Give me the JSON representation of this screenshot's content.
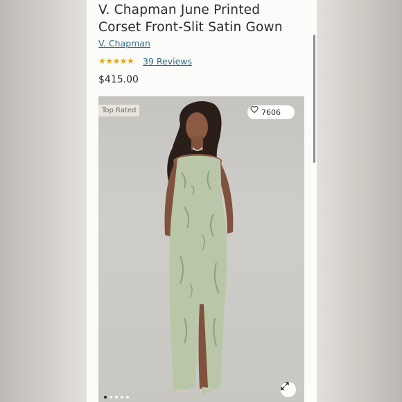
{
  "product": {
    "title_line1": "V. Chapman June Printed",
    "title_line2": "Corset Front-Slit Satin Gown",
    "brand": "V. Chapman",
    "rating": 4.5,
    "reviews_label": "39 Reviews",
    "price": "$415.00"
  },
  "gallery": {
    "badge": "Top Rated",
    "like_count": "7606",
    "image_count": 5,
    "active_image": 1,
    "image_description_icon": "model-in-gown-photo"
  },
  "colors": {
    "link": "#2f6f86",
    "star": "#e0a92a",
    "gown": "#b9c7a8"
  }
}
